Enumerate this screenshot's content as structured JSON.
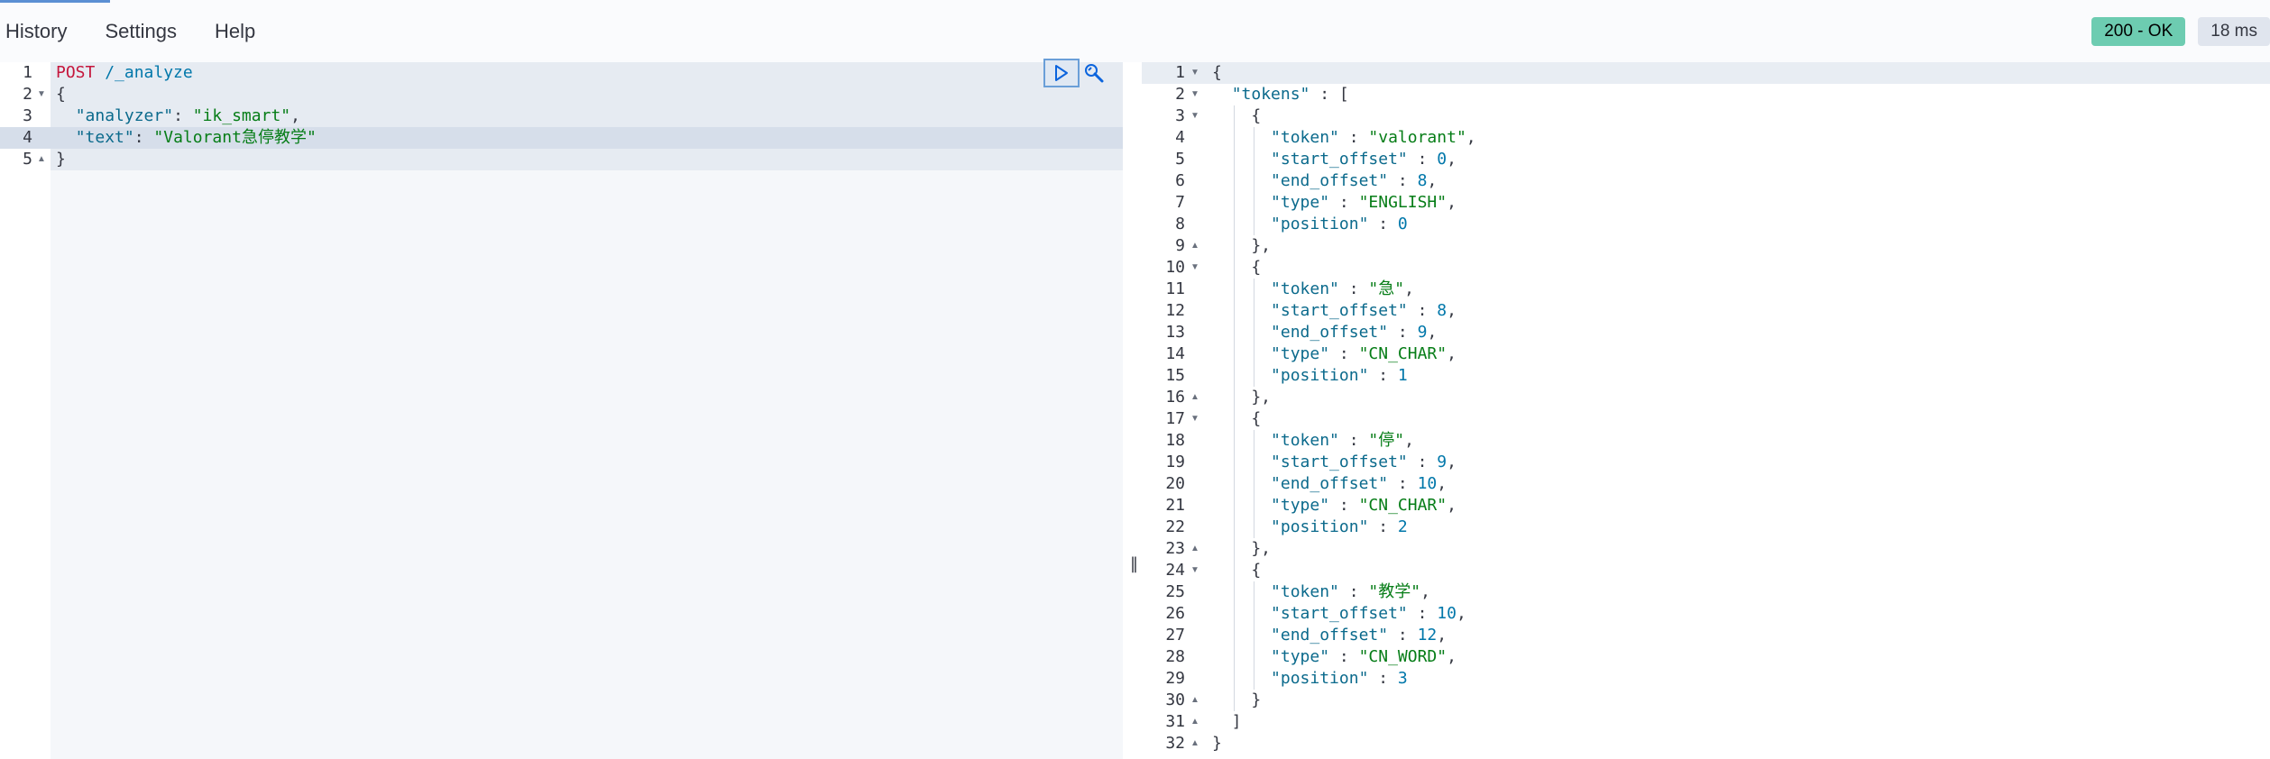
{
  "menu": {
    "history": "History",
    "settings": "Settings",
    "help": "Help"
  },
  "status": {
    "code": "200 - OK",
    "time": "18 ms"
  },
  "icons": {
    "run": "play-icon",
    "wrench": "wrench-icon",
    "resizer": "resize-grip-icon"
  },
  "colors": {
    "status_ok": "#6dccb1",
    "method": "#c5163c",
    "string": "#067d17",
    "key": "#0b6a8c"
  },
  "request": {
    "method": "POST",
    "path": "/_analyze",
    "open_brace": "{",
    "close_brace": "}",
    "analyzer_key": "\"analyzer\"",
    "analyzer_value": "\"ik_smart\"",
    "text_key": "\"text\"",
    "text_value": "\"Valorant急停教学\""
  },
  "response": {
    "lines": [
      "{",
      "  \"tokens\" : [",
      "    {",
      "      \"token\" : \"valorant\",",
      "      \"start_offset\" : 0,",
      "      \"end_offset\" : 8,",
      "      \"type\" : \"ENGLISH\",",
      "      \"position\" : 0",
      "    },",
      "    {",
      "      \"token\" : \"急\",",
      "      \"start_offset\" : 8,",
      "      \"end_offset\" : 9,",
      "      \"type\" : \"CN_CHAR\",",
      "      \"position\" : 1",
      "    },",
      "    {",
      "      \"token\" : \"停\",",
      "      \"start_offset\" : 9,",
      "      \"end_offset\" : 10,",
      "      \"type\" : \"CN_CHAR\",",
      "      \"position\" : 2",
      "    },",
      "    {",
      "      \"token\" : \"教学\",",
      "      \"start_offset\" : 10,",
      "      \"end_offset\" : 12,",
      "      \"type\" : \"CN_WORD\",",
      "      \"position\" : 3",
      "    }",
      "  ]",
      "}"
    ]
  }
}
